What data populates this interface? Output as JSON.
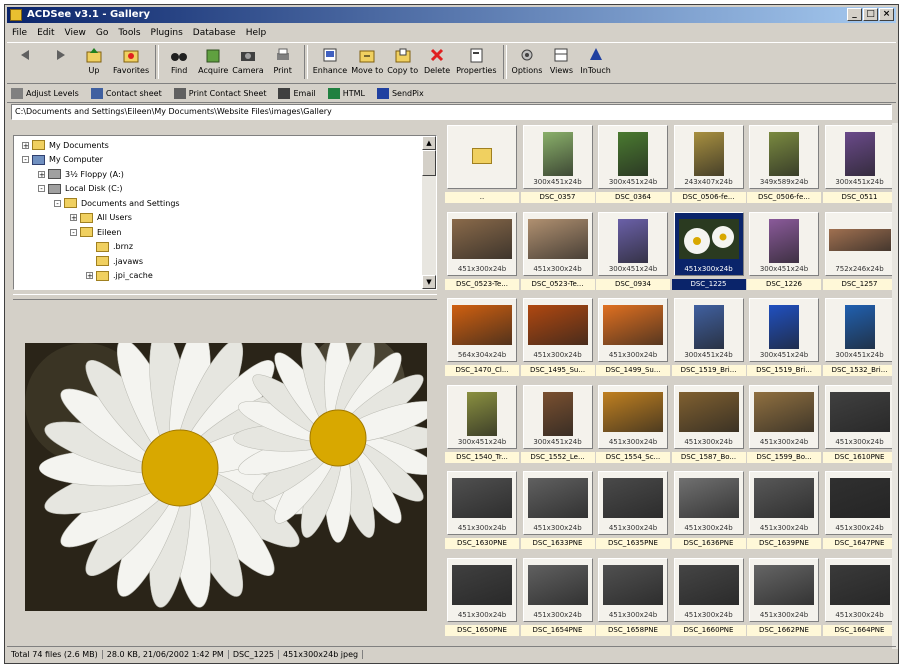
{
  "window": {
    "title": "ACDSee v3.1 - Gallery"
  },
  "menu": [
    "File",
    "Edit",
    "View",
    "Go",
    "Tools",
    "Plugins",
    "Database",
    "Help"
  ],
  "toolbar1": [
    {
      "label": "",
      "icon": "back-icon"
    },
    {
      "label": "",
      "icon": "forward-icon"
    },
    {
      "label": "Up",
      "icon": "up-folder-icon"
    },
    {
      "label": "Favorites",
      "icon": "favorites-icon"
    },
    {
      "label": "Find",
      "icon": "binoculars-icon"
    },
    {
      "label": "Acquire",
      "icon": "acquire-icon"
    },
    {
      "label": "Camera",
      "icon": "camera-icon"
    },
    {
      "label": "Print",
      "icon": "printer-icon"
    },
    {
      "label": "Enhance",
      "icon": "enhance-icon"
    },
    {
      "label": "Move to",
      "icon": "move-to-icon"
    },
    {
      "label": "Copy to",
      "icon": "copy-to-icon"
    },
    {
      "label": "Delete",
      "icon": "delete-icon"
    },
    {
      "label": "Properties",
      "icon": "properties-icon"
    },
    {
      "label": "Options",
      "icon": "options-icon"
    },
    {
      "label": "Views",
      "icon": "views-icon"
    },
    {
      "label": "InTouch",
      "icon": "intouch-icon"
    }
  ],
  "toolbar2": [
    "Adjust Levels",
    "Contact sheet",
    "Print Contact Sheet",
    "Email",
    "HTML",
    "SendPix"
  ],
  "address": "C:\\Documents and Settings\\Eileen\\My Documents\\Website Files\\images\\Gallery",
  "tree": [
    {
      "label": "My Documents",
      "level": 0,
      "expander": "+"
    },
    {
      "label": "My Computer",
      "level": 0,
      "expander": "-"
    },
    {
      "label": "3½ Floppy (A:)",
      "level": 1,
      "expander": "+"
    },
    {
      "label": "Local Disk (C:)",
      "level": 1,
      "expander": "-"
    },
    {
      "label": "Documents and Settings",
      "level": 2,
      "expander": "-"
    },
    {
      "label": "All Users",
      "level": 3,
      "expander": "+"
    },
    {
      "label": "Eileen",
      "level": 3,
      "expander": "-"
    },
    {
      "label": ".brnz",
      "level": 4,
      "expander": ""
    },
    {
      "label": ".javaws",
      "level": 4,
      "expander": ""
    },
    {
      "label": ".jpi_cache",
      "level": 4,
      "expander": "+"
    }
  ],
  "thumbnails": [
    {
      "name": "..",
      "dims": "",
      "type": "folder",
      "color": "#f0d060"
    },
    {
      "name": "DSC_0357",
      "dims": "300x451x24b",
      "type": "portrait",
      "color": "#8ab06a"
    },
    {
      "name": "DSC_0364",
      "dims": "300x451x24b",
      "type": "portrait",
      "color": "#4a7a30"
    },
    {
      "name": "DSC_0506-fe...",
      "dims": "243x407x24b",
      "type": "portrait",
      "color": "#a89040"
    },
    {
      "name": "DSC_0506-fe...",
      "dims": "349x589x24b",
      "type": "portrait",
      "color": "#7a8a40"
    },
    {
      "name": "DSC_0511",
      "dims": "300x451x24b",
      "type": "portrait",
      "color": "#6a4a8a"
    },
    {
      "name": "DSC_0523-Te...",
      "dims": "451x300x24b",
      "type": "landscape",
      "color": "#8a6a4a"
    },
    {
      "name": "DSC_0523-Te...",
      "dims": "451x300x24b",
      "type": "landscape",
      "color": "#b09070"
    },
    {
      "name": "DSC_0934",
      "dims": "300x451x24b",
      "type": "portrait",
      "color": "#6a60a8"
    },
    {
      "name": "DSC_1225",
      "dims": "451x300x24b",
      "type": "landscape",
      "color": "#f0f0e8",
      "selected": true
    },
    {
      "name": "DSC_1226",
      "dims": "300x451x24b",
      "type": "portrait",
      "color": "#8a5a9a"
    },
    {
      "name": "DSC_1257",
      "dims": "752x246x24b",
      "type": "wide",
      "color": "#a07050"
    },
    {
      "name": "DSC_1470_Cl...",
      "dims": "564x304x24b",
      "type": "landscape",
      "color": "#d06010"
    },
    {
      "name": "DSC_1495_Su...",
      "dims": "451x300x24b",
      "type": "landscape",
      "color": "#b04810"
    },
    {
      "name": "DSC_1499_Su...",
      "dims": "451x300x24b",
      "type": "landscape",
      "color": "#e07020"
    },
    {
      "name": "DSC_1519_Bri...",
      "dims": "300x451x24b",
      "type": "portrait",
      "color": "#4060a0"
    },
    {
      "name": "DSC_1519_Bri...",
      "dims": "300x451x24b",
      "type": "portrait",
      "color": "#2050c0"
    },
    {
      "name": "DSC_1532_Bri...",
      "dims": "300x451x24b",
      "type": "portrait",
      "color": "#2060b0"
    },
    {
      "name": "DSC_1540_Tr...",
      "dims": "300x451x24b",
      "type": "portrait",
      "color": "#8a9040"
    },
    {
      "name": "DSC_1552_Le...",
      "dims": "300x451x24b",
      "type": "portrait",
      "color": "#7a5030"
    },
    {
      "name": "DSC_1554_Sc...",
      "dims": "451x300x24b",
      "type": "landscape",
      "color": "#c08020"
    },
    {
      "name": "DSC_1587_Bo...",
      "dims": "451x300x24b",
      "type": "landscape",
      "color": "#806030"
    },
    {
      "name": "DSC_1599_Bo...",
      "dims": "451x300x24b",
      "type": "landscape",
      "color": "#907040"
    },
    {
      "name": "DSC_1610PNE",
      "dims": "451x300x24b",
      "type": "landscape",
      "color": "#404040"
    },
    {
      "name": "DSC_1630PNE",
      "dims": "451x300x24b",
      "type": "landscape",
      "color": "#505050"
    },
    {
      "name": "DSC_1633PNE",
      "dims": "451x300x24b",
      "type": "landscape",
      "color": "#606060"
    },
    {
      "name": "DSC_1635PNE",
      "dims": "451x300x24b",
      "type": "landscape",
      "color": "#4a4a4a"
    },
    {
      "name": "DSC_1636PNE",
      "dims": "451x300x24b",
      "type": "landscape",
      "color": "#707070"
    },
    {
      "name": "DSC_1639PNE",
      "dims": "451x300x24b",
      "type": "landscape",
      "color": "#585858"
    },
    {
      "name": "DSC_1647PNE",
      "dims": "451x300x24b",
      "type": "landscape",
      "color": "#303030"
    },
    {
      "name": "DSC_1650PNE",
      "dims": "451x300x24b",
      "type": "landscape",
      "color": "#404040"
    },
    {
      "name": "DSC_1654PNE",
      "dims": "451x300x24b",
      "type": "landscape",
      "color": "#606060"
    },
    {
      "name": "DSC_1658PNE",
      "dims": "451x300x24b",
      "type": "landscape",
      "color": "#505050"
    },
    {
      "name": "DSC_1660PNE",
      "dims": "451x300x24b",
      "type": "landscape",
      "color": "#454545"
    },
    {
      "name": "DSC_1662PNE",
      "dims": "451x300x24b",
      "type": "landscape",
      "color": "#656565"
    },
    {
      "name": "DSC_1664PNE",
      "dims": "451x300x24b",
      "type": "landscape",
      "color": "#3a3a3a"
    }
  ],
  "status": {
    "total": "Total 74 files (2.6 MB)",
    "info": "28.0 KB, 21/06/2002 1:42 PM",
    "file": "DSC_1225",
    "format": "451x300x24b jpeg"
  },
  "colors": {
    "titlebar": "#0a246a",
    "face": "#d4d0c8",
    "selection": "#0a246a"
  }
}
